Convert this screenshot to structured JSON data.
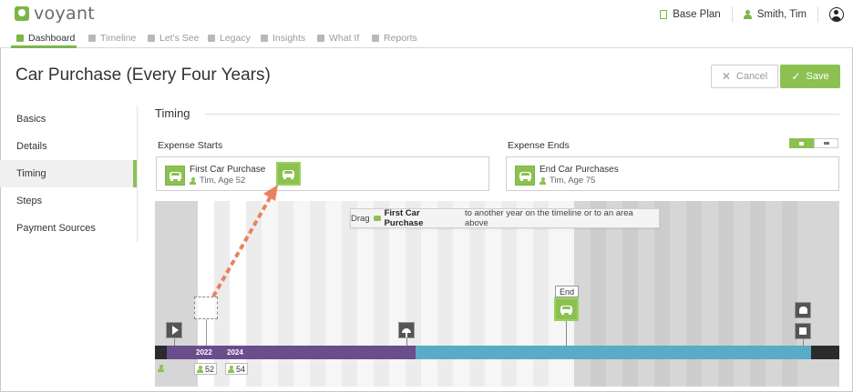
{
  "header": {
    "logo_text": "voyant",
    "plan_label": "Base Plan",
    "user_name": "Smith, Tim"
  },
  "nav": {
    "items": [
      {
        "label": "Dashboard",
        "icon": "dashboard-icon",
        "active": true
      },
      {
        "label": "Timeline",
        "icon": "hourglass-icon"
      },
      {
        "label": "Let's See",
        "icon": "bar-chart-icon"
      },
      {
        "label": "Legacy",
        "icon": "legacy-icon"
      },
      {
        "label": "Insights",
        "icon": "lightbulb-icon"
      },
      {
        "label": "What If",
        "icon": "what-if-icon"
      },
      {
        "label": "Reports",
        "icon": "reports-icon"
      }
    ]
  },
  "page": {
    "title": "Car Purchase (Every Four Years)",
    "cancel_label": "Cancel",
    "save_label": "Save"
  },
  "sidebar": {
    "items": [
      {
        "label": "Basics"
      },
      {
        "label": "Details"
      },
      {
        "label": "Timing",
        "active": true
      },
      {
        "label": "Steps"
      },
      {
        "label": "Payment Sources"
      }
    ]
  },
  "timing": {
    "section_title": "Timing",
    "expense_starts_label": "Expense Starts",
    "expense_ends_label": "Expense Ends",
    "start": {
      "title": "First Car Purchase",
      "who": "Tim, Age 52"
    },
    "end": {
      "title": "End Car Purchases",
      "who": "Tim, Age 75"
    }
  },
  "timeline": {
    "tooltip_prefix": "Drag",
    "tooltip_bold": "First Car Purchase",
    "tooltip_suffix": "to another year on the timeline or to an area above",
    "end_label": "End",
    "year_labels": [
      "2022",
      "2024"
    ],
    "age_chips": [
      "52",
      "54"
    ]
  },
  "colors": {
    "accent_green": "#8cc152",
    "purple_bar": "#6b4c8c",
    "blue_bar": "#5aaac8",
    "arrow_orange": "#e8825e"
  }
}
